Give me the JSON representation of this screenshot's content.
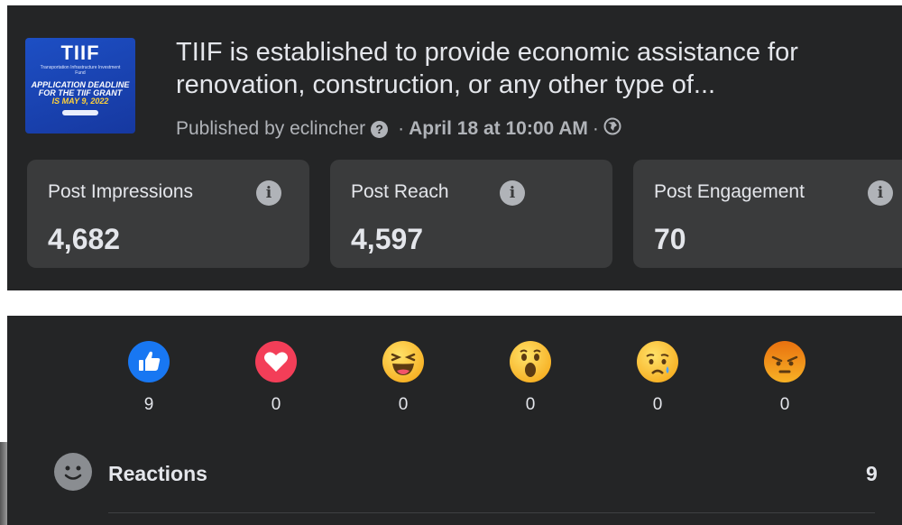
{
  "post": {
    "thumbnail": {
      "title": "TIIF",
      "subtitle": "Transportation Infrastructure Investment Fund",
      "deadline_text": "APPLICATION DEADLINE FOR THE TIIF GRANT",
      "deadline_date": "IS MAY 9, 2022"
    },
    "text": "TIIF is established to provide economic assistance for renovation, construction, or any other type of...",
    "published_prefix": "Published by eclincher",
    "help_icon": "question-circle-icon",
    "separator": "·",
    "date": "April 18 at 10:00 AM",
    "audience_icon": "globe-icon"
  },
  "stats": [
    {
      "label": "Post Impressions",
      "value": "4,682"
    },
    {
      "label": "Post Reach",
      "value": "4,597"
    },
    {
      "label": "Post Engagement",
      "value": "70"
    }
  ],
  "info_icon_glyph": "i",
  "reactions": [
    {
      "type": "like",
      "icon": "thumbs-up-icon",
      "count": "9"
    },
    {
      "type": "love",
      "icon": "heart-icon",
      "count": "0"
    },
    {
      "type": "haha",
      "icon": "laughing-face-icon",
      "count": "0"
    },
    {
      "type": "wow",
      "icon": "surprised-face-icon",
      "count": "0"
    },
    {
      "type": "sad",
      "icon": "sad-face-icon",
      "count": "0"
    },
    {
      "type": "angry",
      "icon": "angry-face-icon",
      "count": "0"
    }
  ],
  "reactions_summary": {
    "label": "Reactions",
    "total": "9",
    "icon": "smiley-icon"
  },
  "colors": {
    "panel": "#242526",
    "card": "#3a3b3c",
    "text": "#e4e6eb",
    "muted": "#b0b3b8",
    "like": "#1877f2",
    "love": "#f33e58"
  }
}
